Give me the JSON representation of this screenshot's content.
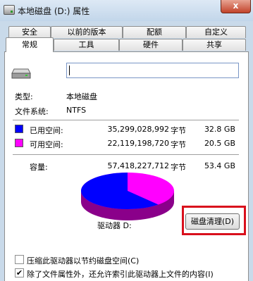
{
  "window": {
    "title": "本地磁盘 (D:) 属性",
    "close_label": "x",
    "close_icon": "close-icon",
    "icon": "drive-icon"
  },
  "tabs": {
    "row1": [
      "安全",
      "以前的版本",
      "配额",
      "自定义"
    ],
    "row2": [
      "常规",
      "工具",
      "硬件",
      "共享"
    ],
    "active": "常规"
  },
  "general": {
    "drive_icon": "hard-drive-icon",
    "name_value": "",
    "type_label": "类型:",
    "type_value": "本地磁盘",
    "fs_label": "文件系统:",
    "fs_value": "NTFS",
    "used": {
      "label": "已用空间:",
      "bytes": "35,299,028,992",
      "unit": "字节",
      "size": "32.8 GB",
      "color": "#0000ff"
    },
    "free": {
      "label": "可用空间:",
      "bytes": "22,119,198,720",
      "unit": "字节",
      "size": "20.5 GB",
      "color": "#ff00ff"
    },
    "capacity": {
      "label": "容量:",
      "bytes": "57,418,227,712",
      "unit": "字节",
      "size": "53.4 GB"
    },
    "drive_label": "驱动器 D:",
    "cleanup_button": "磁盘清理(D)",
    "highlight_color": "#d9101c",
    "compress_checkbox": {
      "label": "压缩此驱动器以节约磁盘空间(C)",
      "checked": false
    },
    "index_checkbox": {
      "label": "除了文件属性外，还允许索引此驱动器上文件的内容(I)",
      "checked": true,
      "check_mark": "✔"
    }
  }
}
